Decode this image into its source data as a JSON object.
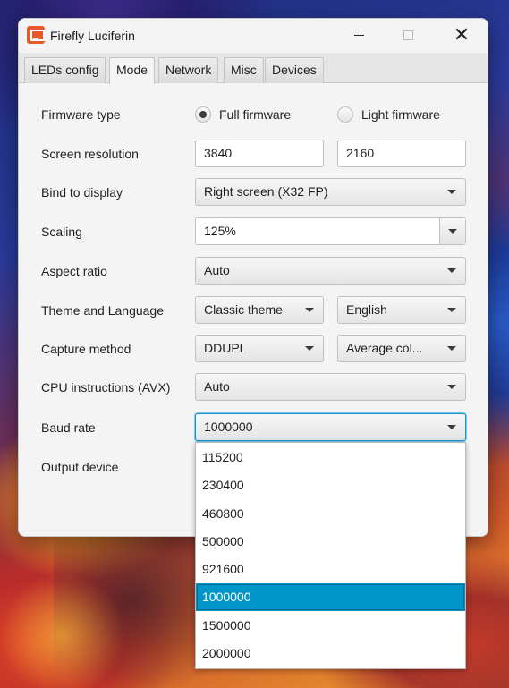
{
  "window": {
    "title": "Firefly Luciferin"
  },
  "tabs": [
    {
      "label": "LEDs config",
      "active": false
    },
    {
      "label": "Mode",
      "active": true
    },
    {
      "label": "Network",
      "active": false
    },
    {
      "label": "Misc",
      "active": false
    },
    {
      "label": "Devices",
      "active": false
    }
  ],
  "form": {
    "firmware_type": {
      "label": "Firmware type",
      "options": [
        "Full firmware",
        "Light firmware"
      ],
      "selected": "Full firmware"
    },
    "screen_resolution": {
      "label": "Screen resolution",
      "width": "3840",
      "height": "2160"
    },
    "bind_to_display": {
      "label": "Bind to display",
      "value": "Right screen (X32 FP)"
    },
    "scaling": {
      "label": "Scaling",
      "value": "125%"
    },
    "aspect_ratio": {
      "label": "Aspect ratio",
      "value": "Auto"
    },
    "theme_language": {
      "label": "Theme and Language",
      "theme": "Classic theme",
      "language": "English"
    },
    "capture_method": {
      "label": "Capture method",
      "method": "DDUPL",
      "color_mode": "Average col..."
    },
    "cpu_instructions": {
      "label": "CPU instructions (AVX)",
      "value": "Auto"
    },
    "baud_rate": {
      "label": "Baud rate",
      "value": "1000000"
    },
    "output_device": {
      "label": "Output device"
    }
  },
  "baud_dropdown": {
    "options": [
      "115200",
      "230400",
      "460800",
      "500000",
      "921600",
      "1000000",
      "1500000",
      "2000000"
    ],
    "selected": "1000000"
  },
  "colors": {
    "accent": "#0096c9",
    "focus": "#1a94cc",
    "app_icon": "#e8582d"
  }
}
